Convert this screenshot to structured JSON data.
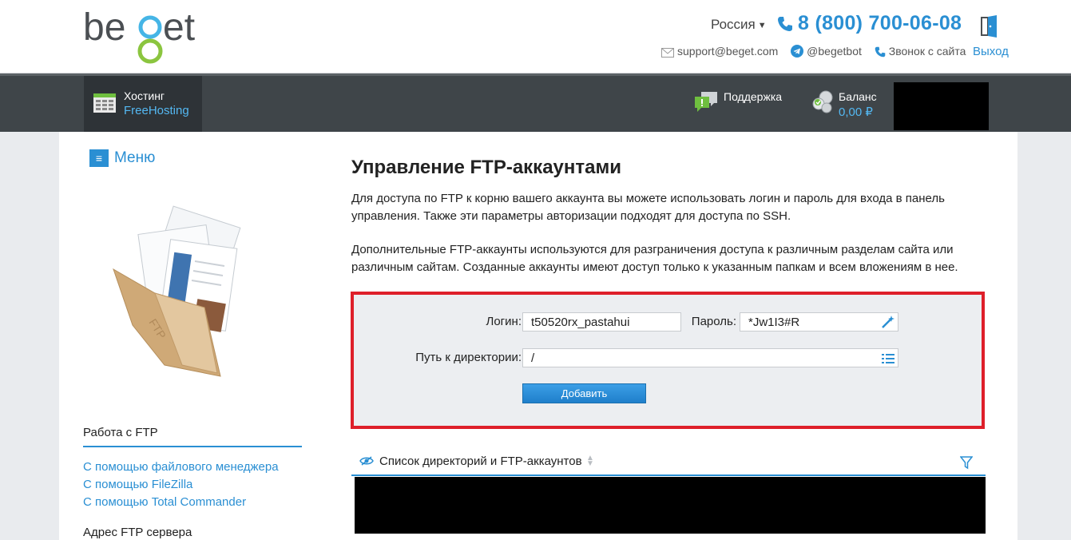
{
  "header": {
    "logo_text": "beget",
    "region": "Россия",
    "phone": "8 (800) 700-06-08",
    "contacts": {
      "email": "support@beget.com",
      "telegram": "@begetbot",
      "callback": "Звонок с сайта"
    },
    "logout": "Выход"
  },
  "nav": {
    "hosting_title": "Хостинг",
    "hosting_plan": "FreeHosting",
    "support": "Поддержка",
    "balance_label": "Баланс",
    "balance_value": "0,00 ₽"
  },
  "sidebar": {
    "menu_label": "Меню",
    "section1_title": "Работа с FTP",
    "links": [
      "С помощью файлового менеджера",
      "С помощью FileZilla",
      "С помощью Total Commander"
    ],
    "section2_title": "Адрес FTP сервера"
  },
  "content": {
    "title": "Управление FTP-аккаунтами",
    "paragraph1": "Для доступа по FTP к корню вашего аккаунта вы можете использовать логин и пароль для входа в панель управления. Также эти параметры авторизации подходят для доступа по SSH.",
    "paragraph2": "Дополнительные FTP-аккаунты используются для разграничения доступа к различным разделам сайта или различным сайтам. Созданные аккаунты имеют доступ только к указанным папкам и всем вложениям в нее."
  },
  "form": {
    "login_label": "Логин:",
    "login_value": "t50520rx_pastahui",
    "password_label": "Пароль:",
    "password_value": "*Jw1I3#R",
    "path_label": "Путь к директории:",
    "path_value": "/",
    "add_button": "Добавить"
  },
  "list": {
    "header": "Список директорий и FTP-аккаунтов"
  },
  "colors": {
    "accent": "#2a8fd3",
    "highlight_border": "#de1f2a",
    "nav_bg": "#3f4549"
  }
}
